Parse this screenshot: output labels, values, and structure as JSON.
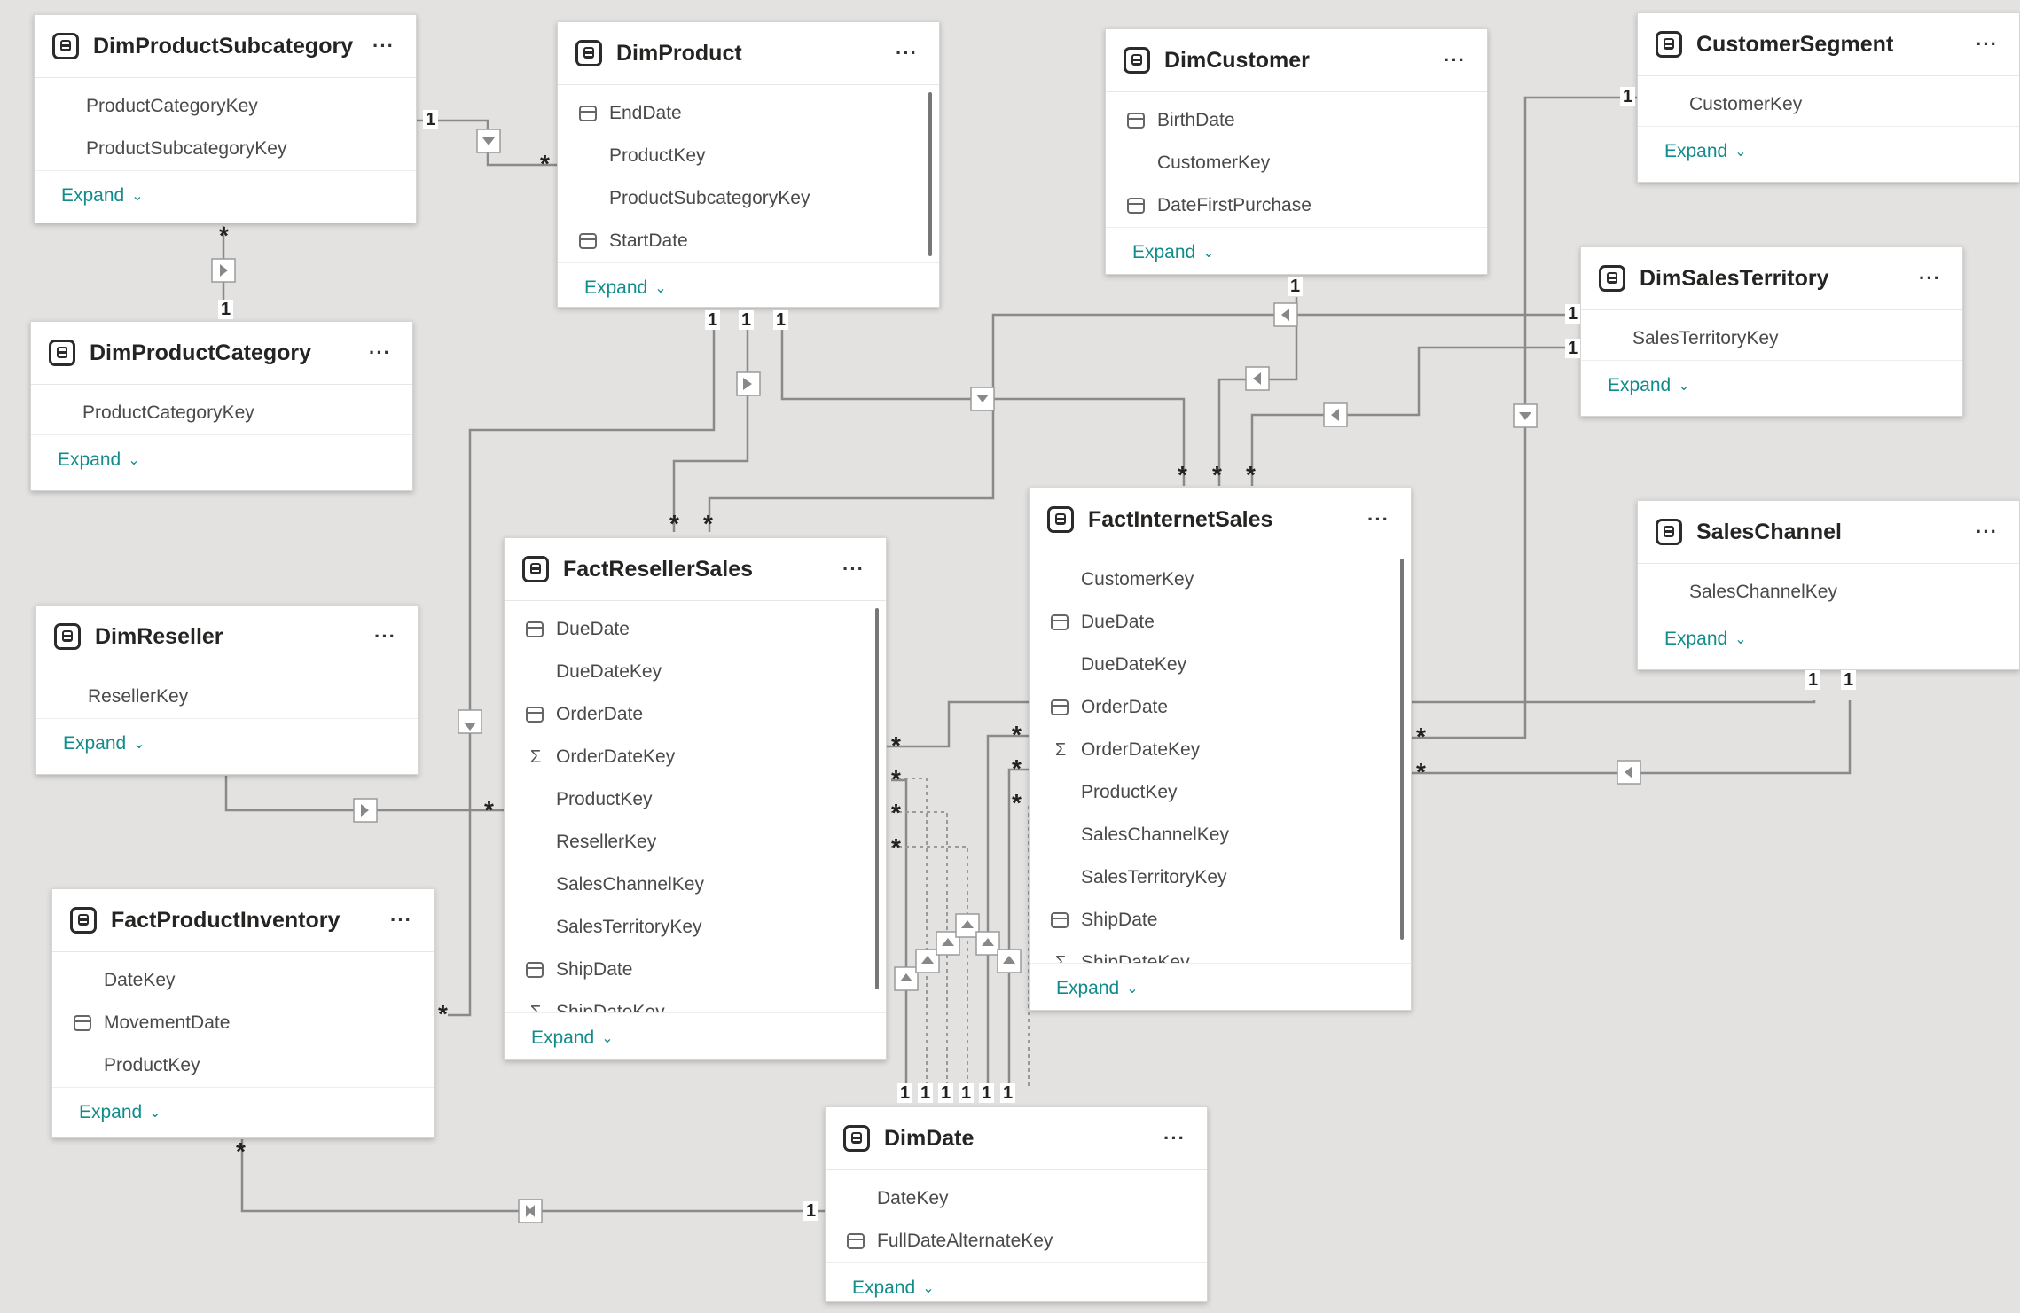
{
  "tables": {
    "dimProductSubcategory": {
      "title": "DimProductSubcategory",
      "fields": [
        "ProductCategoryKey",
        "ProductSubcategoryKey"
      ],
      "expand": "Expand"
    },
    "dimProduct": {
      "title": "DimProduct",
      "fields": [
        "EndDate",
        "ProductKey",
        "ProductSubcategoryKey",
        "StartDate"
      ],
      "expand": "Expand"
    },
    "dimCustomer": {
      "title": "DimCustomer",
      "fields": [
        "BirthDate",
        "CustomerKey",
        "DateFirstPurchase"
      ],
      "expand": "Expand"
    },
    "customerSegment": {
      "title": "CustomerSegment",
      "fields": [
        "CustomerKey"
      ],
      "expand": "Expand"
    },
    "dimProductCategory": {
      "title": "DimProductCategory",
      "fields": [
        "ProductCategoryKey"
      ],
      "expand": "Expand"
    },
    "dimSalesTerritory": {
      "title": "DimSalesTerritory",
      "fields": [
        "SalesTerritoryKey"
      ],
      "expand": "Expand"
    },
    "factInternetSales": {
      "title": "FactInternetSales",
      "fields": [
        "CustomerKey",
        "DueDate",
        "DueDateKey",
        "OrderDate",
        "OrderDateKey",
        "ProductKey",
        "SalesChannelKey",
        "SalesTerritoryKey",
        "ShipDate",
        "ShipDateKey"
      ],
      "expand": "Expand"
    },
    "salesChannel": {
      "title": "SalesChannel",
      "fields": [
        "SalesChannelKey"
      ],
      "expand": "Expand"
    },
    "factResellerSales": {
      "title": "FactResellerSales",
      "fields": [
        "DueDate",
        "DueDateKey",
        "OrderDate",
        "OrderDateKey",
        "ProductKey",
        "ResellerKey",
        "SalesChannelKey",
        "SalesTerritoryKey",
        "ShipDate",
        "ShipDateKey"
      ],
      "expand": "Expand"
    },
    "dimReseller": {
      "title": "DimReseller",
      "fields": [
        "ResellerKey"
      ],
      "expand": "Expand"
    },
    "factProductInventory": {
      "title": "FactProductInventory",
      "fields": [
        "DateKey",
        "MovementDate",
        "ProductKey"
      ],
      "expand": "Expand"
    },
    "dimDate": {
      "title": "DimDate",
      "fields": [
        "DateKey",
        "FullDateAlternateKey"
      ],
      "expand": "Expand"
    }
  },
  "icons": {
    "table": "table-icon",
    "more": "more-options-icon",
    "date": "calendar-icon",
    "sum": "sigma-icon",
    "expand": "chevron-down-icon"
  },
  "symbols": {
    "one": "1",
    "many": "*"
  },
  "colors": {
    "canvas": "#e3e2e0",
    "line": "#7a7a7a",
    "expand": "#118b8b",
    "card": "#ffffff"
  }
}
